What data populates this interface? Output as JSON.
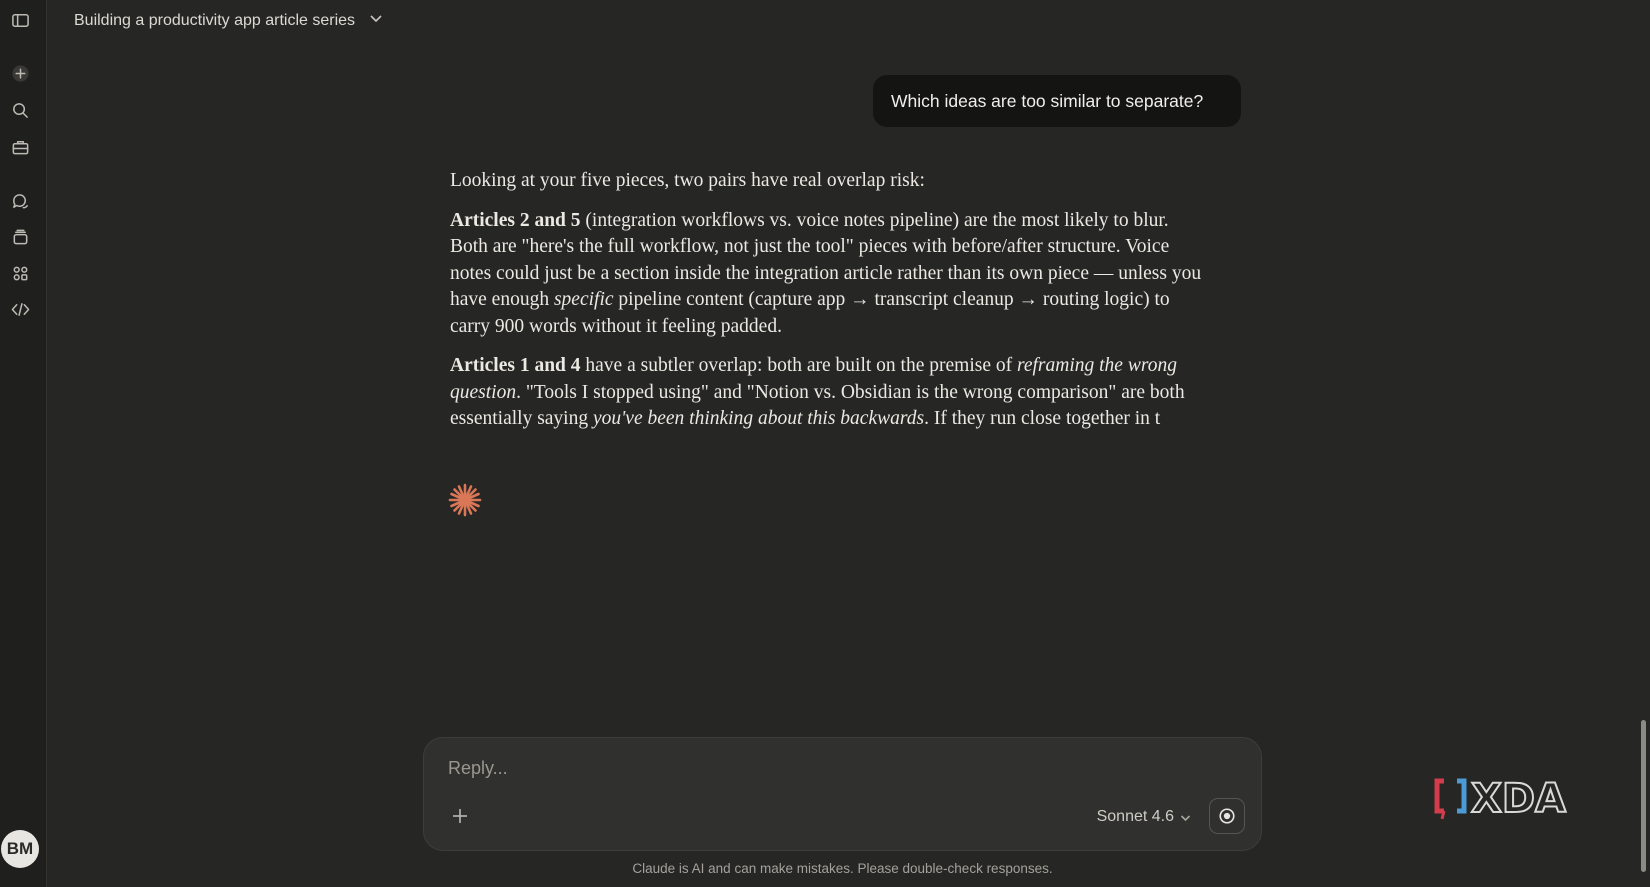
{
  "header": {
    "title": "Building a productivity app article series"
  },
  "sidebar": {
    "items": [
      {
        "icon": "sidebar-toggle-icon"
      },
      {
        "icon": "plus-icon"
      },
      {
        "icon": "search-icon"
      },
      {
        "icon": "briefcase-icon"
      },
      {
        "icon": "chat-bubbles-icon"
      },
      {
        "icon": "stack-icon"
      },
      {
        "icon": "apps-grid-icon"
      },
      {
        "icon": "code-icon"
      }
    ],
    "avatar_initials": "BM"
  },
  "conversation": {
    "user_message": "Which ideas are too similar to separate?",
    "assistant": {
      "p1": "Looking at your five pieces, two pairs have real overlap risk:",
      "p2_bold": "Articles 2 and 5",
      "p2_a": " (integration workflows vs. voice notes pipeline) are the most likely to blur. Both are \"here's the full workflow, not just the tool\" pieces with before/after structure. Voice notes could just be a section inside the integration article rather than its own piece — unless you have enough ",
      "p2_italic": "specific",
      "p2_b": " pipeline content (capture app → transcript cleanup → routing logic) to carry 900 words without it feeling padded.",
      "p3_bold": "Articles 1 and 4",
      "p3_a": " have a subtler overlap: both are built on the premise of ",
      "p3_italic1": "reframing the wrong question",
      "p3_b": ". \"Tools I stopped using\" and \"Notion vs. Obsidian is the wrong comparison\" are both essentially saying ",
      "p3_italic2": "you've been thinking about this backwards",
      "p3_c": ". If they run close together in t"
    }
  },
  "composer": {
    "placeholder": "Reply...",
    "model_label": "Sonnet 4.6"
  },
  "footer": {
    "disclaimer": "Claude is AI and can make mistakes. Please double-check responses."
  },
  "watermark": {
    "text": "XDA"
  },
  "colors": {
    "background": "#262624",
    "sidebar": "#1f1f1d",
    "user_bubble": "#141413",
    "accent_spark": "#d97757"
  }
}
